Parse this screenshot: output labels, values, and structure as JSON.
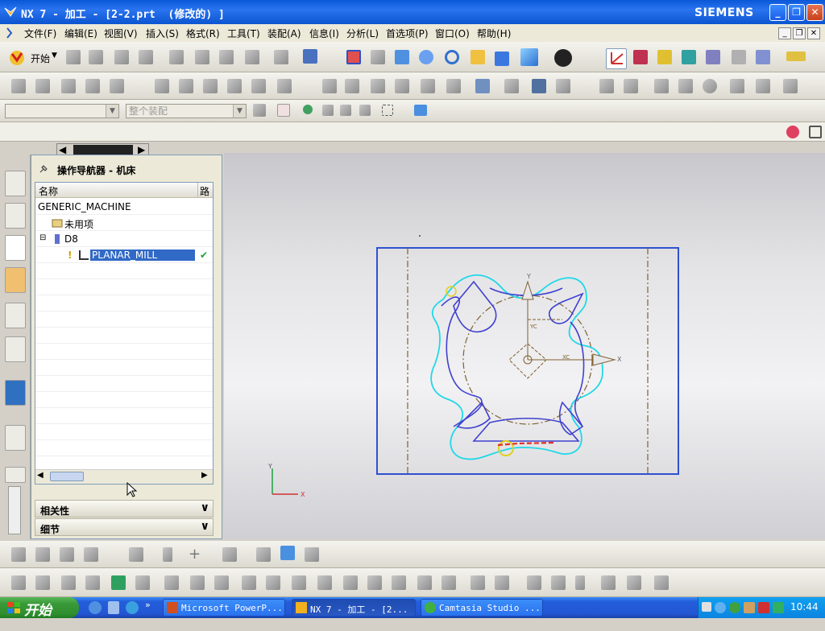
{
  "window": {
    "title": "NX 7 - 加工 - [2-2.prt  (修改的) ]",
    "brand": "SIEMENS"
  },
  "menu": [
    "文件(F)",
    "编辑(E)",
    "视图(V)",
    "插入(S)",
    "格式(R)",
    "工具(T)",
    "装配(A)",
    "信息(I)",
    "分析(L)",
    "首选项(P)",
    "窗口(O)",
    "帮助(H)"
  ],
  "toolbar": {
    "start_label": "开始",
    "filter_placeholder": "整个装配"
  },
  "navigator": {
    "title": "操作导航器 - 机床",
    "columns": [
      "名称",
      "路"
    ],
    "rows": [
      {
        "label": "GENERIC_MACHINE"
      },
      {
        "label": "未用项"
      },
      {
        "label": "D8"
      },
      {
        "label": "PLANAR_MILL",
        "selected": true
      }
    ],
    "sections": [
      "相关性",
      "细节"
    ]
  },
  "viewport": {
    "axes": {
      "x": "X",
      "y": "Y",
      "xc": "XC",
      "yc": "YC"
    },
    "colors": {
      "frame": "#3050d0",
      "boundary": "#20d8e8",
      "part": "#4040d0",
      "center": "#806030"
    }
  },
  "taskbar": {
    "start": "开始",
    "tasks": [
      "Microsoft PowerP...",
      "NX 7 - 加工 - [2...",
      "Camtasia Studio ..."
    ],
    "clock": "10:44"
  }
}
